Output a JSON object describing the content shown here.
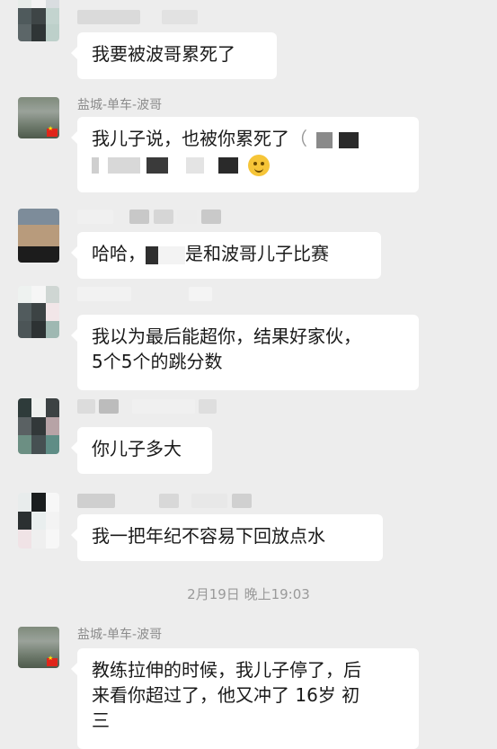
{
  "messages": [
    {
      "text": "我要被波哥累死了"
    },
    {
      "sender": "盐城-单车-波哥",
      "line1": "我儿子说，也被你累死了",
      "line1_tail": "（"
    },
    {
      "text_a": "哈哈，",
      "text_b": "是和波哥儿子比赛"
    },
    {
      "line1": "我以为最后能超你，结果好家伙，",
      "line2": "5个5个的跳分数"
    },
    {
      "text": "你儿子多大"
    },
    {
      "text": "我一把年纪不容易下回放点水"
    },
    {
      "sender": "盐城-单车-波哥",
      "line1": "教练拉伸的时候，我儿子停了，后",
      "line2": "来看你超过了，他又冲了 16岁 初",
      "line3": "三"
    }
  ],
  "timestamp": "2月19日 晚上19:03",
  "icons": {
    "emoji": "thinking-face-icon",
    "flag": "china-flag-icon"
  },
  "colors": {
    "background": "#ededed",
    "bubble": "#ffffff",
    "name_text": "#8c8c8c"
  }
}
